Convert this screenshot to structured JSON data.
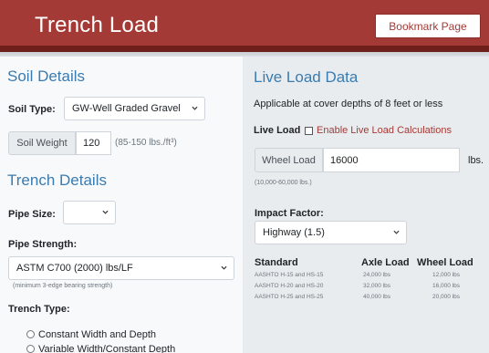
{
  "header": {
    "title": "Trench Load",
    "bookmark_label": "Bookmark Page"
  },
  "soil": {
    "heading": "Soil Details",
    "type_label": "Soil Type:",
    "type_value": "GW-Well Graded Gravel",
    "weight_addon": "Soil Weight",
    "weight_value": "120",
    "weight_range": "(85-150 lbs./ft³)"
  },
  "trench": {
    "heading": "Trench Details",
    "pipe_size_label": "Pipe Size:",
    "pipe_size_value": "",
    "pipe_strength_label": "Pipe Strength:",
    "pipe_strength_value": "ASTM C700 (2000) lbs/LF",
    "pipe_strength_note": "(minimum 3-edge bearing strength)",
    "trench_type_label": "Trench Type:",
    "trench_type_options": [
      "Constant Width and Depth",
      "Variable Width/Constant Depth"
    ]
  },
  "live_load": {
    "heading": "Live Load Data",
    "applicability": "Applicable at cover depths of 8 feet or less",
    "live_load_label": "Live Load",
    "enable_label": "Enable Live Load Calculations",
    "wheel_addon": "Wheel Load",
    "wheel_value": "16000",
    "wheel_unit": "lbs.",
    "wheel_range": "(10,000-60,000 lbs.)",
    "impact_label": "Impact Factor:",
    "impact_value": "Highway (1.5)",
    "table": {
      "headers": [
        "Standard",
        "Axle Load",
        "Wheel Load"
      ],
      "rows": [
        [
          "AASHTO H-15 and HS-15",
          "24,000 lbs",
          "12,000 lbs"
        ],
        [
          "AASHTO H-20 and HS-20",
          "32,000 lbs",
          "16,000 lbs"
        ],
        [
          "AASHTO H-25 and HS-25",
          "40,000 lbs",
          "20,000 lbs"
        ]
      ]
    }
  },
  "colors": {
    "header_red": "#a33a36",
    "heading_blue": "#3a7bb0",
    "checkbox_label_red": "#a33a36"
  }
}
